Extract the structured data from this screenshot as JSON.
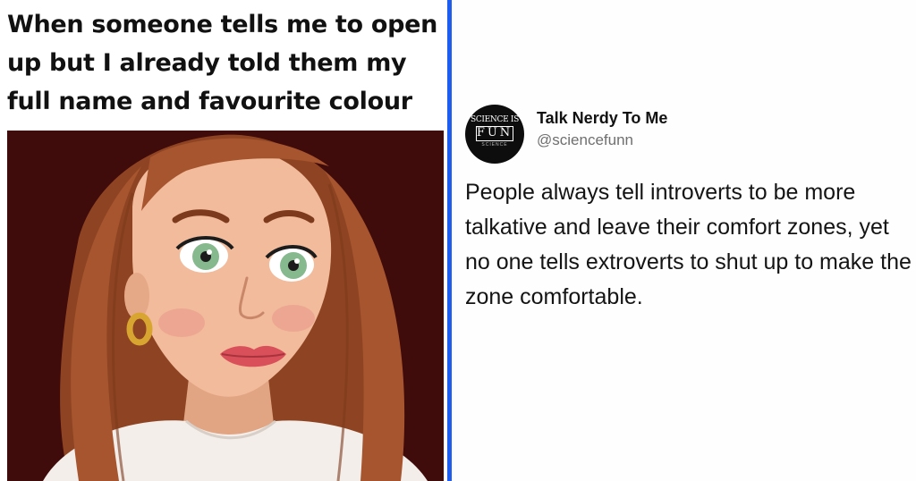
{
  "meme": {
    "caption": "When someone tells me to open up but I already told them my full name and favourite colour"
  },
  "tweet": {
    "avatar": {
      "line1": "SCIENCE IS",
      "line2": "FUN",
      "line3": "SCIENCE"
    },
    "display_name": "Talk Nerdy To Me",
    "handle": "@sciencefunn",
    "text": "People always tell introverts to be more talkative and leave their comfort zones, yet no one tells extroverts to shut up to make the zone comfortable."
  },
  "colors": {
    "divider": "#1d5df2",
    "art_background": "#4a0f0e",
    "hair": "#a6552f",
    "skin": "#f1bb9c",
    "lips": "#d9505a",
    "eyes": "#86b98d",
    "shirt": "#f3eeea"
  }
}
